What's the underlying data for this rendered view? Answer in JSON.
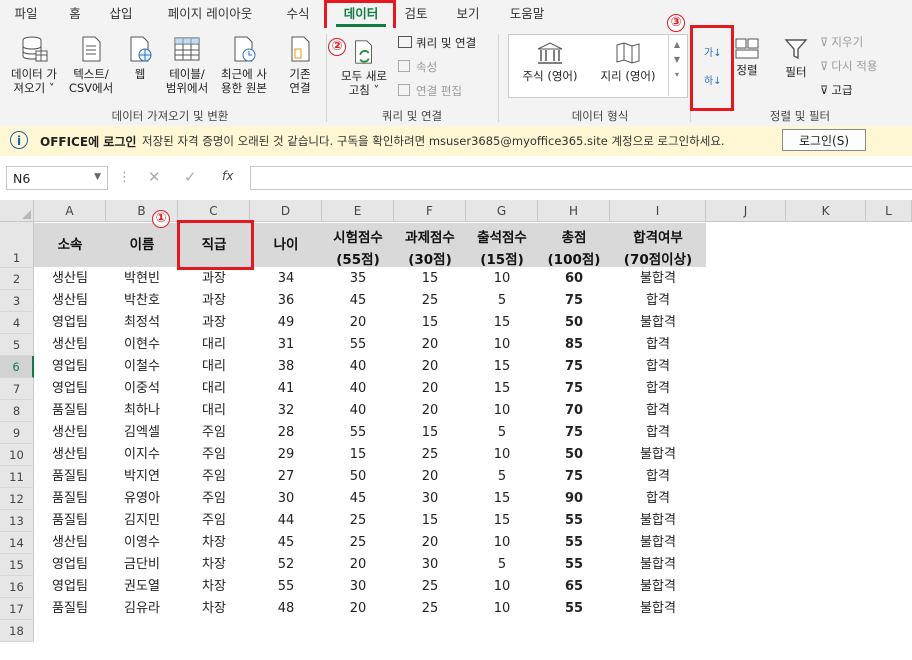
{
  "tabs": [
    "파일",
    "홈",
    "삽입",
    "페이지 레이아웃",
    "수식",
    "데이터",
    "검토",
    "보기",
    "도움말"
  ],
  "active_tab": "데이터",
  "ribbon": {
    "get_data": {
      "btn1_line1": "데이터 가",
      "btn1_line2": "져오기 ˅",
      "btn2_line1": "텍스트/",
      "btn2_line2": "CSV에서",
      "btn3": "웹",
      "btn4_line1": "테이블/",
      "btn4_line2": "범위에서",
      "btn5_line1": "최근에 사",
      "btn5_line2": "용한 원본",
      "btn6_line1": "기존",
      "btn6_line2": "연결",
      "group": "데이터 가져오기 및 변환"
    },
    "queries": {
      "refresh_line1": "모두 새로",
      "refresh_line2": "고침 ˅",
      "queries_conn": "쿼리 및 연결",
      "properties": "속성",
      "edit_links": "연결 편집",
      "group": "쿼리 및 연결"
    },
    "data_types": {
      "stocks": "주식 (영어)",
      "geo": "지리 (영어)",
      "group": "데이터 형식"
    },
    "sort_filter": {
      "sort_az": "가↓",
      "sort_za": "하↓",
      "sort": "정렬",
      "filter": "필터",
      "clear": "지우기",
      "reapply": "다시 적용",
      "advanced": "고급",
      "group": "정렬 및 필터"
    },
    "markers": [
      "①",
      "②",
      "③"
    ]
  },
  "message_bar": {
    "title": "OFFICE에 로그인",
    "text": "저장된 자격 증명이 오래된 것 같습니다. 구독을 확인하려면 msuser3685@myoffice365.site 계정으로 로그인하세요.",
    "button": "로그인(S)"
  },
  "formula_bar": {
    "name_box": "N6",
    "fx": "fx",
    "value": ""
  },
  "columns": [
    "A",
    "B",
    "C",
    "D",
    "E",
    "F",
    "G",
    "H",
    "I",
    "J",
    "K",
    "L"
  ],
  "header_row": [
    {
      "l1": "소속",
      "l2": ""
    },
    {
      "l1": "이름",
      "l2": ""
    },
    {
      "l1": "직급",
      "l2": ""
    },
    {
      "l1": "나이",
      "l2": ""
    },
    {
      "l1": "시험점수",
      "l2": "(55점)"
    },
    {
      "l1": "과제점수",
      "l2": "(30점)"
    },
    {
      "l1": "출석점수",
      "l2": "(15점)"
    },
    {
      "l1": "총점",
      "l2": "(100점)"
    },
    {
      "l1": "합격여부",
      "l2": "(70점이상)"
    }
  ],
  "rows": [
    [
      "생산팀",
      "박현빈",
      "과장",
      "34",
      "35",
      "15",
      "10",
      "60",
      "불합격"
    ],
    [
      "생산팀",
      "박찬호",
      "과장",
      "36",
      "45",
      "25",
      "5",
      "75",
      "합격"
    ],
    [
      "영업팀",
      "최정석",
      "과장",
      "49",
      "20",
      "15",
      "15",
      "50",
      "불합격"
    ],
    [
      "생산팀",
      "이현수",
      "대리",
      "31",
      "55",
      "20",
      "10",
      "85",
      "합격"
    ],
    [
      "영업팀",
      "이철수",
      "대리",
      "38",
      "40",
      "20",
      "15",
      "75",
      "합격"
    ],
    [
      "영업팀",
      "이중석",
      "대리",
      "41",
      "40",
      "20",
      "15",
      "75",
      "합격"
    ],
    [
      "품질팀",
      "최하나",
      "대리",
      "32",
      "40",
      "20",
      "10",
      "70",
      "합격"
    ],
    [
      "생산팀",
      "김엑셀",
      "주임",
      "28",
      "55",
      "15",
      "5",
      "75",
      "합격"
    ],
    [
      "생산팀",
      "이지수",
      "주임",
      "29",
      "15",
      "25",
      "10",
      "50",
      "불합격"
    ],
    [
      "품질팀",
      "박지연",
      "주임",
      "27",
      "50",
      "20",
      "5",
      "75",
      "합격"
    ],
    [
      "품질팀",
      "유영아",
      "주임",
      "30",
      "45",
      "30",
      "15",
      "90",
      "합격"
    ],
    [
      "품질팀",
      "김지민",
      "주임",
      "44",
      "25",
      "15",
      "15",
      "55",
      "불합격"
    ],
    [
      "생산팀",
      "이영수",
      "차장",
      "45",
      "25",
      "20",
      "10",
      "55",
      "불합격"
    ],
    [
      "영업팀",
      "금단비",
      "차장",
      "52",
      "20",
      "30",
      "5",
      "55",
      "불합격"
    ],
    [
      "영업팀",
      "권도열",
      "차장",
      "55",
      "30",
      "25",
      "10",
      "65",
      "불합격"
    ],
    [
      "품질팀",
      "김유라",
      "차장",
      "48",
      "20",
      "25",
      "10",
      "55",
      "불합격"
    ]
  ],
  "row_numbers": [
    "1",
    "2",
    "3",
    "4",
    "5",
    "6",
    "7",
    "8",
    "9",
    "10",
    "11",
    "12",
    "13",
    "14",
    "15",
    "16",
    "17",
    "18"
  ]
}
